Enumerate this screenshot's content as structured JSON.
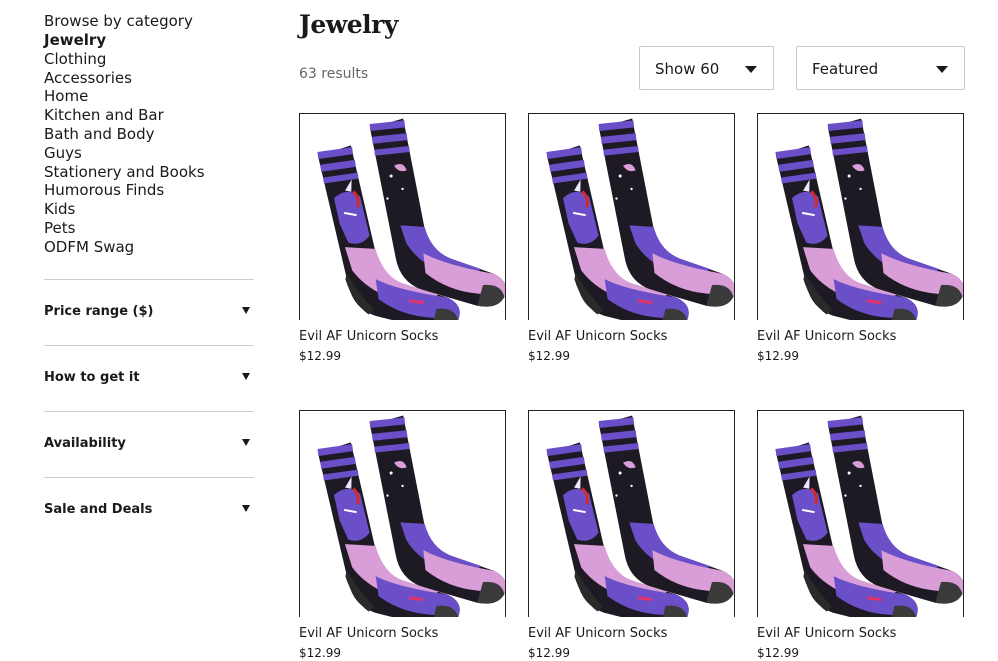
{
  "sidebar": {
    "heading": "Browse by category",
    "categories": [
      {
        "label": "Jewelry",
        "active": true
      },
      {
        "label": "Clothing"
      },
      {
        "label": "Accessories"
      },
      {
        "label": "Home"
      },
      {
        "label": "Kitchen and Bar"
      },
      {
        "label": "Bath and Body"
      },
      {
        "label": "Guys"
      },
      {
        "label": "Stationery and Books"
      },
      {
        "label": "Humorous Finds"
      },
      {
        "label": "Kids"
      },
      {
        "label": "Pets"
      },
      {
        "label": "ODFM Swag"
      }
    ],
    "filters": [
      {
        "label": "Price range ($)",
        "icon": "caret-down-icon"
      },
      {
        "label": "How to get it",
        "icon": "caret-down-icon"
      },
      {
        "label": "Availability",
        "icon": "caret-down-icon"
      },
      {
        "label": "Sale and Deals",
        "icon": "caret-down-icon"
      }
    ]
  },
  "main": {
    "title": "Jewelry",
    "results_text": "63 results",
    "per_page_select": {
      "value": "Show 60"
    },
    "sort_select": {
      "value": "Featured"
    },
    "products": [
      {
        "name": "Evil AF Unicorn Socks",
        "price": "$12.99"
      },
      {
        "name": "Evil AF Unicorn Socks",
        "price": "$12.99"
      },
      {
        "name": "Evil AF Unicorn Socks",
        "price": "$12.99"
      },
      {
        "name": "Evil AF Unicorn Socks",
        "price": "$12.99"
      },
      {
        "name": "Evil AF Unicorn Socks",
        "price": "$12.99"
      },
      {
        "name": "Evil AF Unicorn Socks",
        "price": "$12.99"
      }
    ]
  },
  "colors": {
    "text": "#1a1a1a",
    "muted": "#666666",
    "border": "#c8c8c8",
    "sock_purple": "#6b4fc8",
    "sock_pink": "#d99ed8",
    "sock_black": "#1e1a24"
  }
}
